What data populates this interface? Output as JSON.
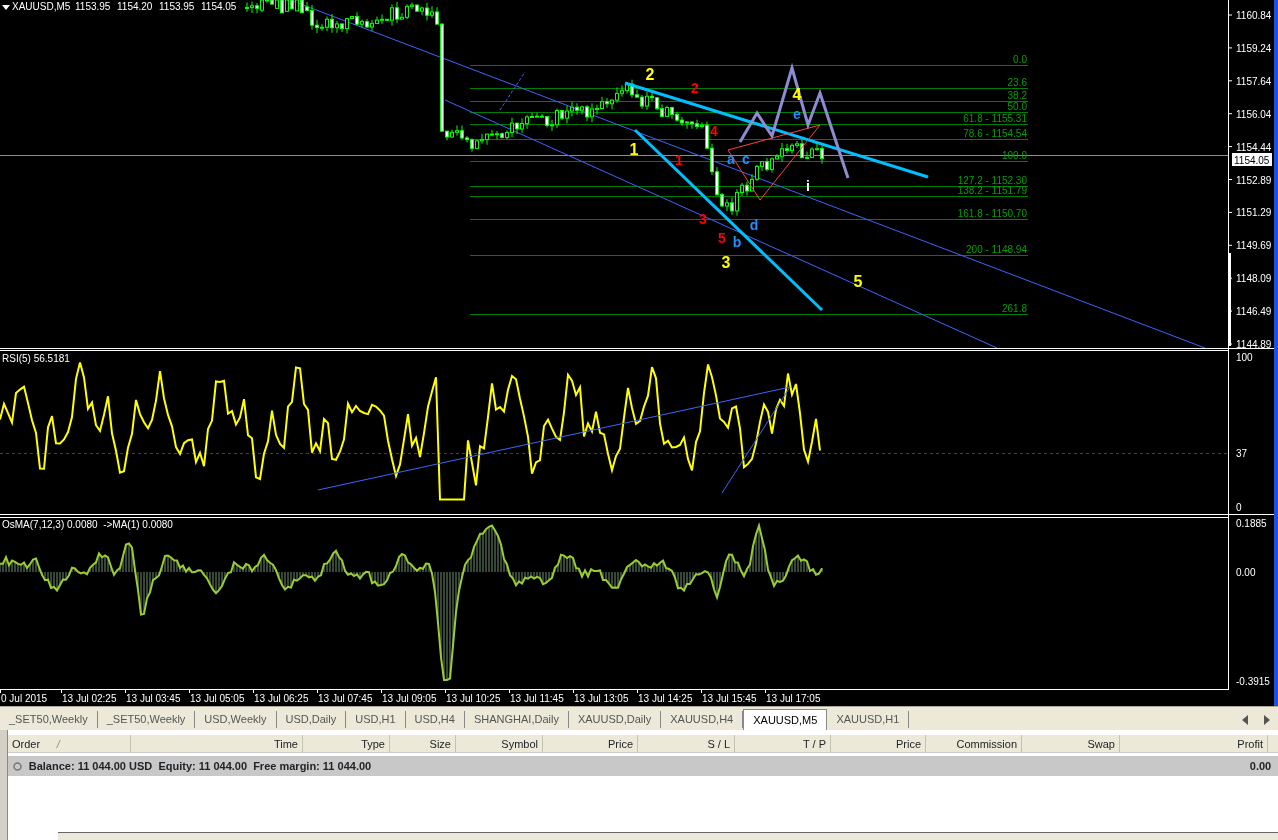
{
  "chart": {
    "symbol": "XAUUSD,M5",
    "quote": [
      "1153.95",
      "1154.20",
      "1153.95",
      "1154.05"
    ],
    "price_axis": [
      "1160.84",
      "1159.24",
      "1157.64",
      "1156.04",
      "1154.44",
      "1152.89",
      "1151.29",
      "1149.69",
      "1148.09",
      "1146.49",
      "1144.89"
    ],
    "current_price": "1154.05",
    "fib_levels": [
      "0.0",
      "23.6",
      "38.2",
      "50.0",
      "61.8 - 1155.31",
      "78.6 - 1154.54",
      "100.0",
      "127.2 - 1152.30",
      "138.2 - 1151.79",
      "161.8 -  1150.70",
      "200 - 1148.94",
      "261.8"
    ],
    "wave_labels": [
      {
        "text": "2",
        "color": "#ffff00"
      },
      {
        "text": "2",
        "color": "#ff0000"
      },
      {
        "text": "4",
        "color": "#ffff00"
      },
      {
        "text": "e",
        "color": "#1e90ff"
      },
      {
        "text": "4",
        "color": "#ff0000"
      },
      {
        "text": "1",
        "color": "#ffff00"
      },
      {
        "text": "1",
        "color": "#ff0000"
      },
      {
        "text": "a",
        "color": "#1e90ff"
      },
      {
        "text": "c",
        "color": "#1e90ff"
      },
      {
        "text": "i",
        "color": "#ffffff"
      },
      {
        "text": "3",
        "color": "#ff0000"
      },
      {
        "text": "b",
        "color": "#1e90ff"
      },
      {
        "text": "d",
        "color": "#1e90ff"
      },
      {
        "text": "5",
        "color": "#ff0000"
      },
      {
        "text": "3",
        "color": "#ffff00"
      },
      {
        "text": "5",
        "color": "#ffff00"
      }
    ]
  },
  "rsi": {
    "title": "RSI(5) 56.5181",
    "axis": [
      "100",
      "37",
      "0"
    ]
  },
  "osma": {
    "title": "OsMA(7,12,3) 0.0080  ->MA(1) 0.0080",
    "axis": [
      "0.1885",
      "0.00",
      "-0.3915"
    ]
  },
  "time_axis": [
    "0 Jul 2015",
    "13 Jul 02:25",
    "13 Jul 03:45",
    "13 Jul 05:05",
    "13 Jul 06:25",
    "13 Jul 07:45",
    "13 Jul 09:05",
    "13 Jul 10:25",
    "13 Jul 11:45",
    "13 Jul 13:05",
    "13 Jul 14:25",
    "13 Jul 15:45",
    "13 Jul 17:05"
  ],
  "tabs": [
    {
      "label": "_SET50,Weekly",
      "selected": false
    },
    {
      "label": "_SET50,Weekly",
      "selected": false
    },
    {
      "label": "USD,Weekly",
      "selected": false
    },
    {
      "label": "USD,Daily",
      "selected": false
    },
    {
      "label": "USD,H1",
      "selected": false
    },
    {
      "label": "USD,H4",
      "selected": false
    },
    {
      "label": "SHANGHAI,Daily",
      "selected": false
    },
    {
      "label": "XAUUSD,Daily",
      "selected": false
    },
    {
      "label": "XAUUSD,H4",
      "selected": false
    },
    {
      "label": "XAUUSD,M5",
      "selected": true
    },
    {
      "label": "XAUUSD,H1",
      "selected": false
    }
  ],
  "terminal": {
    "columns": [
      "Order",
      "Time",
      "Type",
      "Size",
      "Symbol",
      "Price",
      "S / L",
      "T / P",
      "Price",
      "Commission",
      "Swap",
      "Profit"
    ],
    "sort_mark": "/",
    "balance": "Balance: 11 044.00 USD  Equity: 11 044.00  Free margin: 11 044.00",
    "profit": "0.00"
  }
}
